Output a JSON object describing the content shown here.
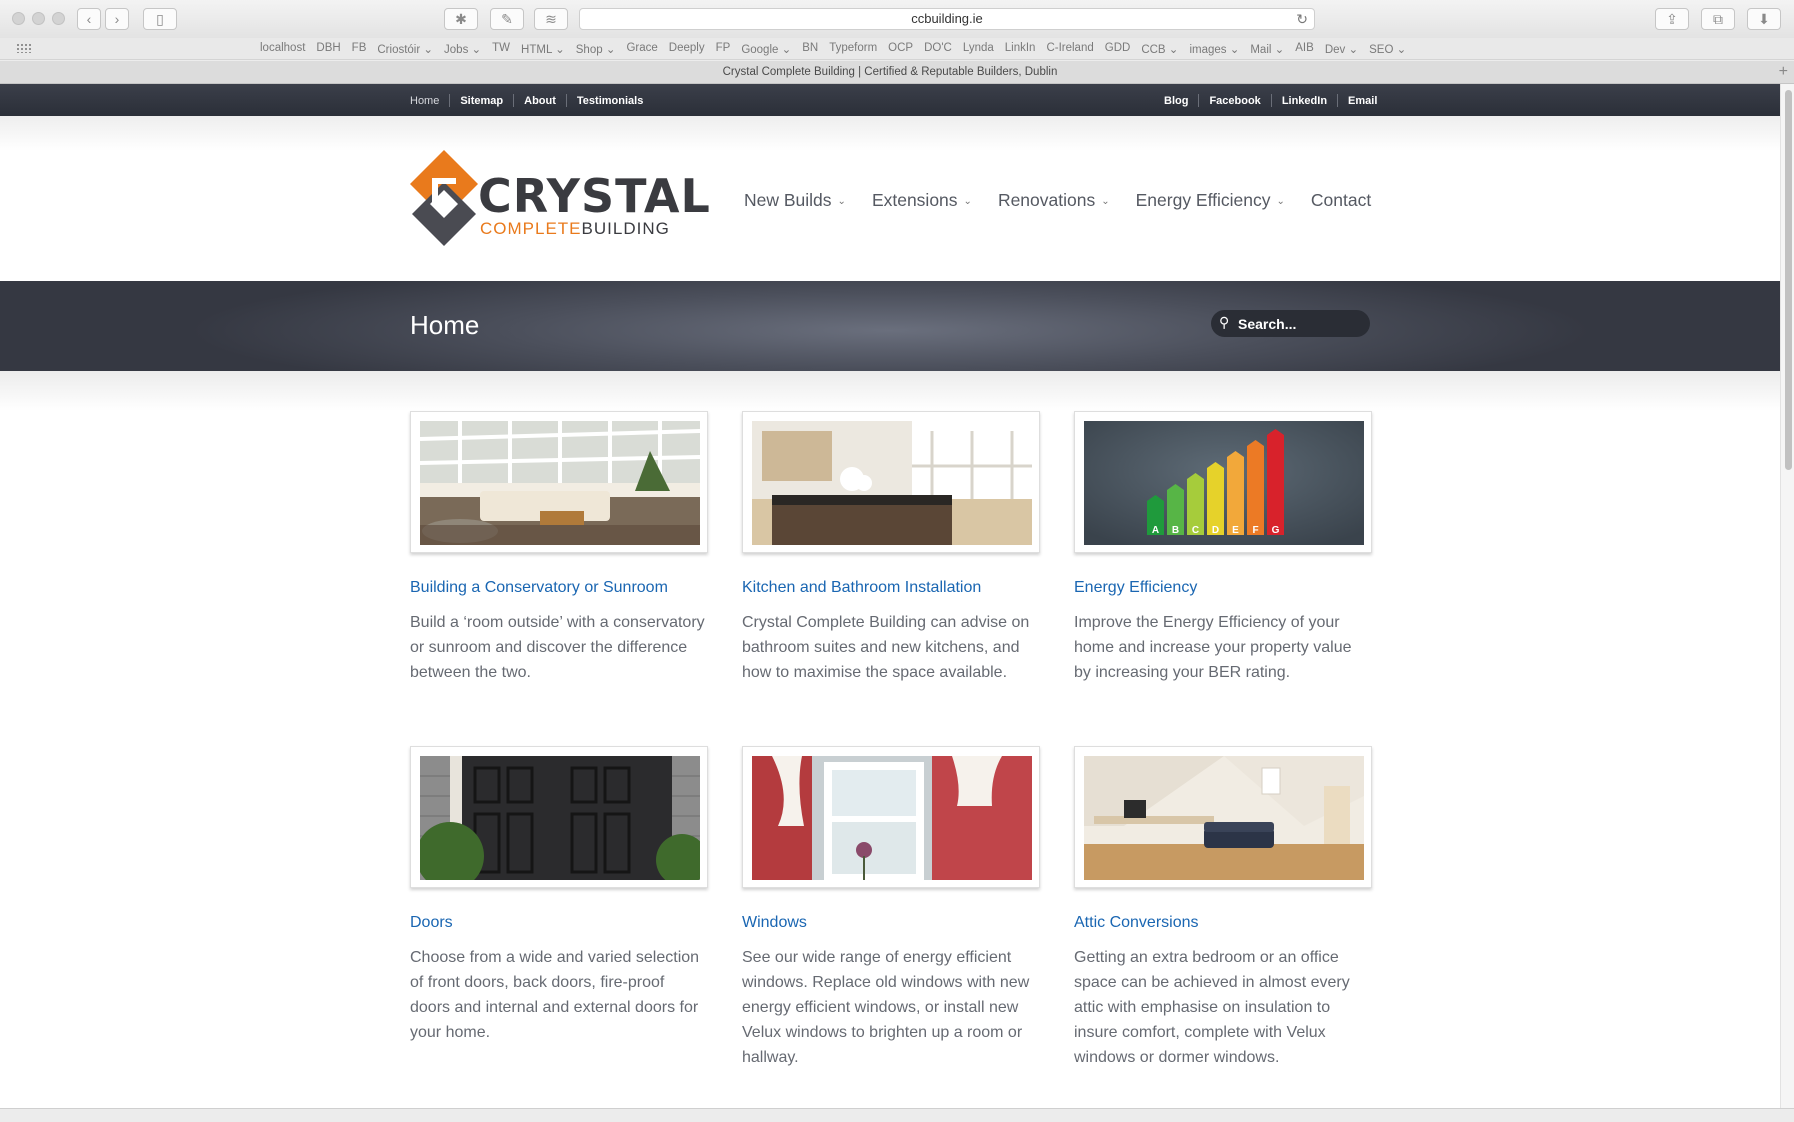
{
  "browser": {
    "url": "ccbuilding.ie",
    "tab_title": "Crystal Complete Building | Certified & Reputable Builders, Dublin",
    "favorites": [
      "localhost",
      "DBH",
      "FB",
      "Criostóir ⌄",
      "Jobs ⌄",
      "TW",
      "HTML ⌄",
      "Shop ⌄",
      "Grace",
      "Deeply",
      "FP",
      "Google ⌄",
      "BN",
      "Typeform",
      "OCP",
      "DO'C",
      "Lynda",
      "LinkIn",
      "C-Ireland",
      "GDD",
      "CCB ⌄",
      "images ⌄",
      "Mail ⌄",
      "AIB",
      "Dev ⌄",
      "SEO ⌄"
    ]
  },
  "topbar": {
    "left": [
      "Home",
      "Sitemap",
      "About",
      "Testimonials"
    ],
    "right": [
      "Blog",
      "Facebook",
      "LinkedIn",
      "Email"
    ]
  },
  "logo": {
    "word": "CRYSTAL",
    "sub1": "COMPLETE",
    "sub2": "BUILDING"
  },
  "mainnav": [
    "New Builds",
    "Extensions",
    "Renovations",
    "Energy Efficiency",
    "Contact"
  ],
  "banner": {
    "title": "Home",
    "search_placeholder": "Search..."
  },
  "cards": [
    {
      "title": "Building a Conservatory or Sunroom",
      "text": "Build a ‘room outside’ with a conservatory or sunroom and discover the difference between the two."
    },
    {
      "title": "Kitchen and Bathroom Installation",
      "text": "Crystal Complete Building can advise on bathroom suites and new kitchens, and how to maximise the space available."
    },
    {
      "title": "Energy Efficiency",
      "text": "Improve the Energy Efficiency of your home and increase your property value by increasing your BER rating."
    },
    {
      "title": "Doors",
      "text": "Choose from a wide and varied selection of front doors, back doors, fire-proof doors and internal and external doors for your home."
    },
    {
      "title": "Windows",
      "text": "See our wide range of energy efficient windows. Replace old windows with new energy efficient windows, or install new Velux windows to brighten up a room or hallway."
    },
    {
      "title": "Attic Conversions",
      "text": "Getting an extra bedroom or an office space can be achieved in almost every attic with emphasise on insulation to insure comfort, complete with Velux windows or dormer windows."
    }
  ],
  "energy_labels": [
    "A",
    "B",
    "C",
    "D",
    "E",
    "F",
    "G"
  ],
  "colors": {
    "accent_orange": "#e97a1c",
    "link_blue": "#1a66b2",
    "dark_bar": "#2b2f38"
  }
}
